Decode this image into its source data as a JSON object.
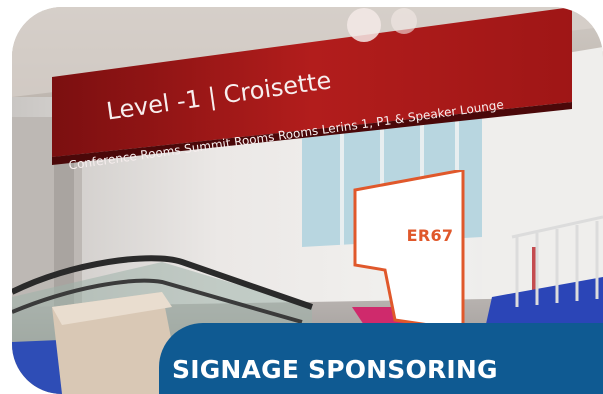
{
  "photo": {
    "sign_level": "Level -1 | Croisette",
    "sign_rooms": "Conference Rooms Summit Rooms Rooms Lerins 1, P1 & Speaker Lounge",
    "speaker_lounge": "Speaker Lounge"
  },
  "tag": {
    "label": "ER67",
    "accent": "#e0582b"
  },
  "caption": {
    "title": "SIGNAGE SPONSORING",
    "bar_color": "#0f5a92"
  }
}
